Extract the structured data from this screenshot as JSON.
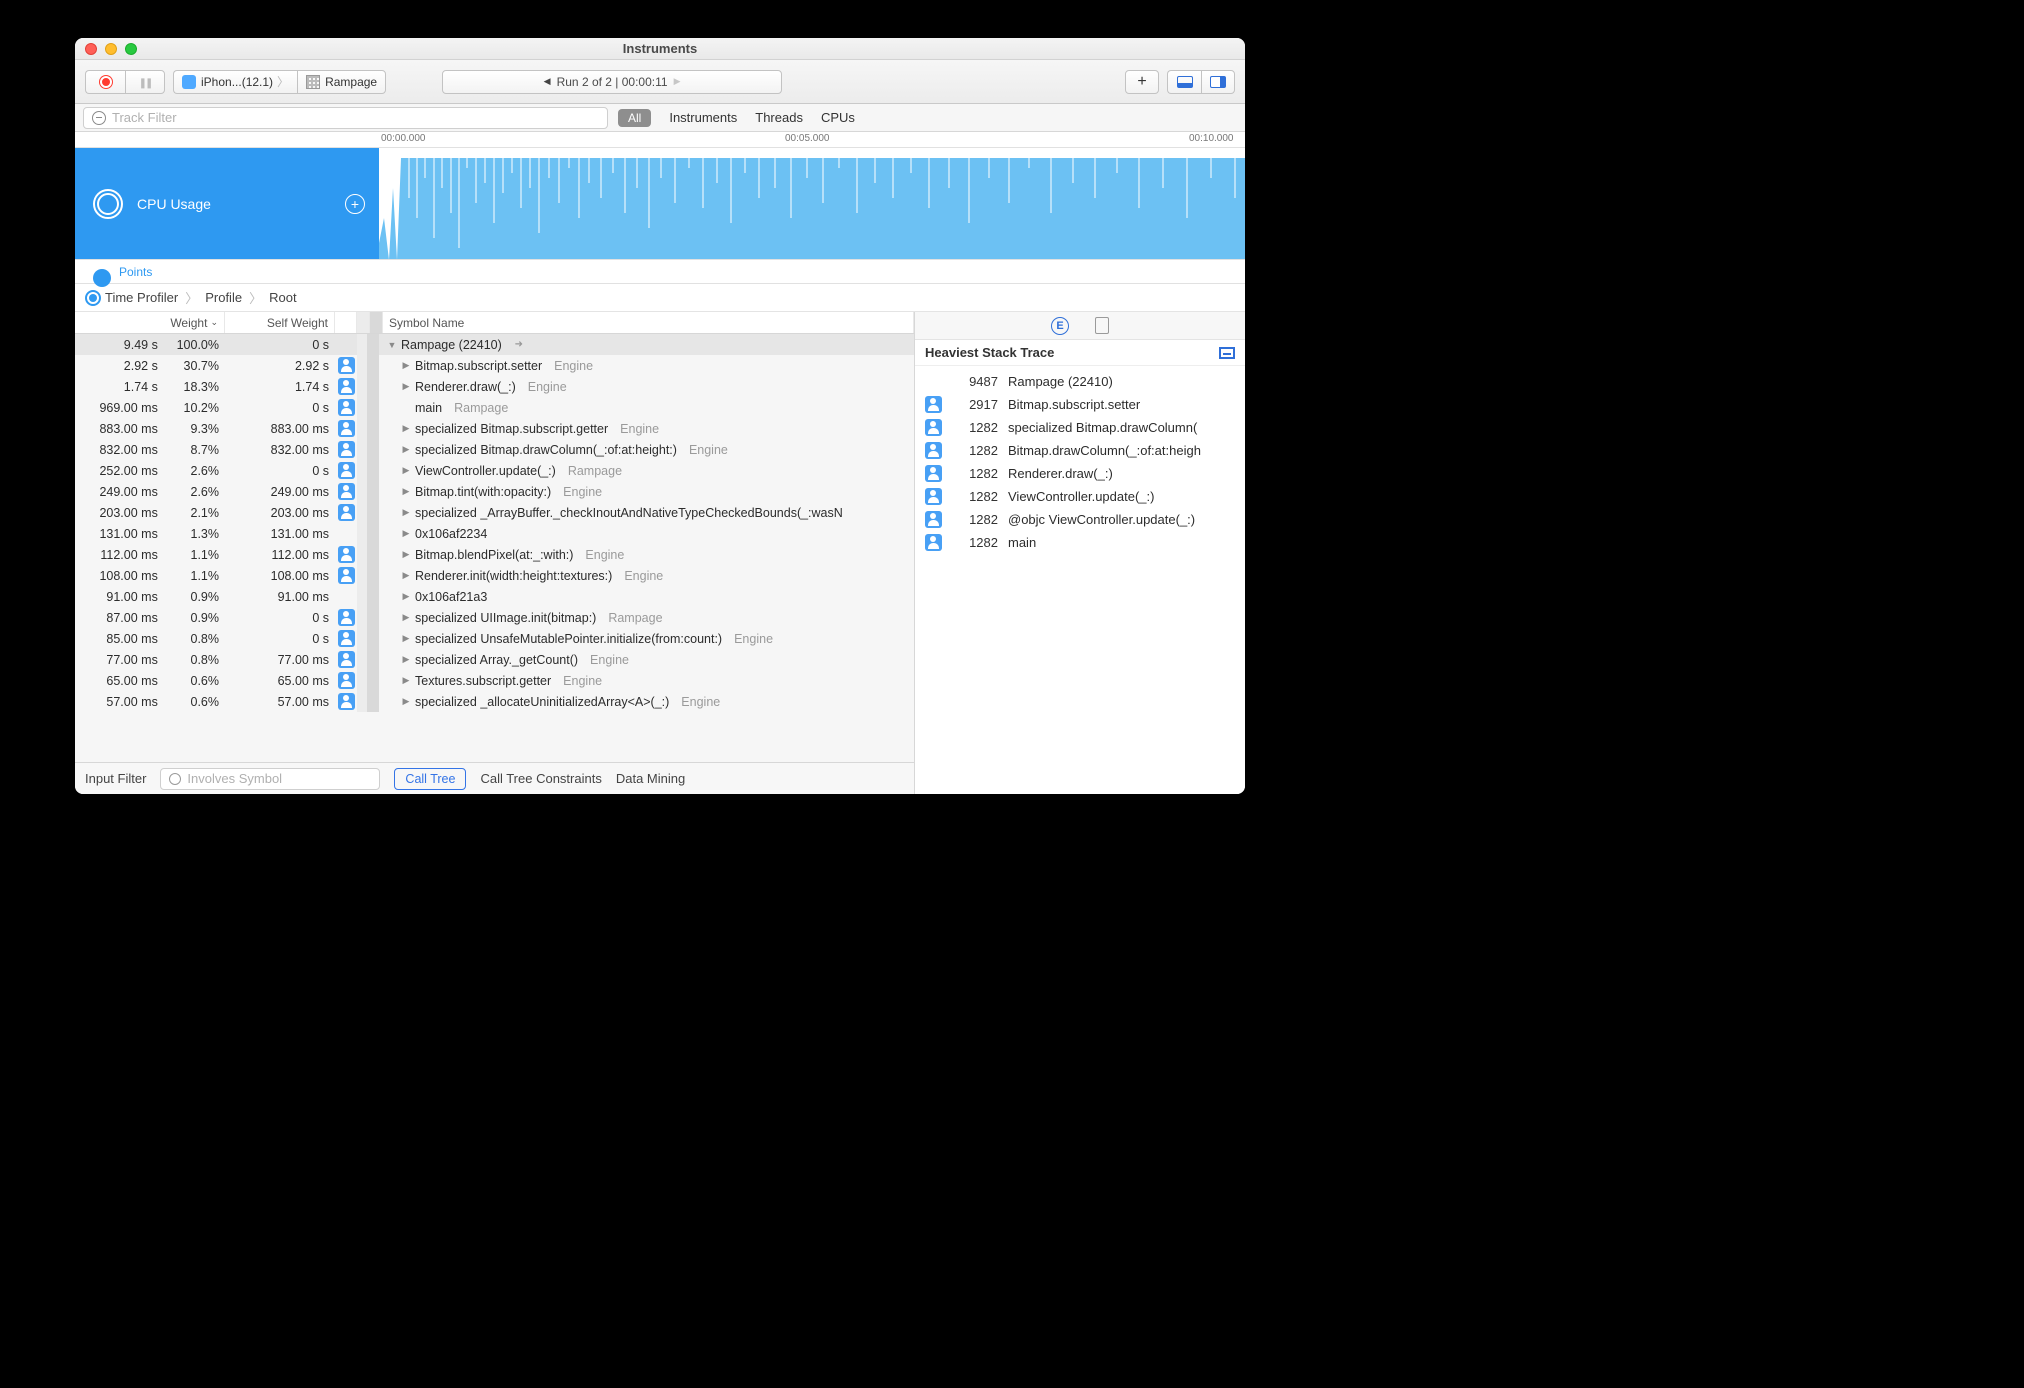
{
  "window": {
    "title": "Instruments"
  },
  "toolbar": {
    "device": "iPhon...(12.1)",
    "target": "Rampage",
    "run_label": "Run 2 of 2  |  00:00:11"
  },
  "filterbar": {
    "placeholder": "Track Filter",
    "all_label": "All",
    "tabs": [
      "Instruments",
      "Threads",
      "CPUs"
    ]
  },
  "ruler": {
    "t0": "00:00.000",
    "t1": "00:05.000",
    "t2": "00:10.000"
  },
  "tracks": {
    "cpu_label": "CPU Usage",
    "points_label": "Points"
  },
  "crumbs": [
    "Time Profiler",
    "Profile",
    "Root"
  ],
  "columns": {
    "weight": "Weight",
    "self_weight": "Self Weight",
    "symbol": "Symbol Name"
  },
  "rows": [
    {
      "weight": "9.49 s",
      "pct": "100.0%",
      "self": "0 s",
      "icon": false,
      "indent": 0,
      "open": true,
      "sym": "Rampage (22410)",
      "lib": "",
      "annot": true,
      "sel": true
    },
    {
      "weight": "2.92 s",
      "pct": "30.7%",
      "self": "2.92 s",
      "icon": true,
      "indent": 1,
      "open": false,
      "sym": "Bitmap.subscript.setter",
      "lib": "Engine"
    },
    {
      "weight": "1.74 s",
      "pct": "18.3%",
      "self": "1.74 s",
      "icon": true,
      "indent": 1,
      "open": false,
      "sym": "Renderer.draw(_:)",
      "lib": "Engine"
    },
    {
      "weight": "969.00 ms",
      "pct": "10.2%",
      "self": "0 s",
      "icon": true,
      "indent": 1,
      "open": null,
      "sym": "main",
      "lib": "Rampage"
    },
    {
      "weight": "883.00 ms",
      "pct": "9.3%",
      "self": "883.00 ms",
      "icon": true,
      "indent": 1,
      "open": false,
      "sym": "specialized Bitmap.subscript.getter",
      "lib": "Engine"
    },
    {
      "weight": "832.00 ms",
      "pct": "8.7%",
      "self": "832.00 ms",
      "icon": true,
      "indent": 1,
      "open": false,
      "sym": "specialized Bitmap.drawColumn(_:of:at:height:)",
      "lib": "Engine"
    },
    {
      "weight": "252.00 ms",
      "pct": "2.6%",
      "self": "0 s",
      "icon": true,
      "indent": 1,
      "open": false,
      "sym": "ViewController.update(_:)",
      "lib": "Rampage"
    },
    {
      "weight": "249.00 ms",
      "pct": "2.6%",
      "self": "249.00 ms",
      "icon": true,
      "indent": 1,
      "open": false,
      "sym": "Bitmap.tint(with:opacity:)",
      "lib": "Engine"
    },
    {
      "weight": "203.00 ms",
      "pct": "2.1%",
      "self": "203.00 ms",
      "icon": true,
      "indent": 1,
      "open": false,
      "sym": "specialized _ArrayBuffer._checkInoutAndNativeTypeCheckedBounds(_:wasN",
      "lib": ""
    },
    {
      "weight": "131.00 ms",
      "pct": "1.3%",
      "self": "131.00 ms",
      "icon": false,
      "indent": 1,
      "open": false,
      "sym": "0x106af2234",
      "lib": ""
    },
    {
      "weight": "112.00 ms",
      "pct": "1.1%",
      "self": "112.00 ms",
      "icon": true,
      "indent": 1,
      "open": false,
      "sym": "Bitmap.blendPixel(at:_:with:)",
      "lib": "Engine"
    },
    {
      "weight": "108.00 ms",
      "pct": "1.1%",
      "self": "108.00 ms",
      "icon": true,
      "indent": 1,
      "open": false,
      "sym": "Renderer.init(width:height:textures:)",
      "lib": "Engine"
    },
    {
      "weight": "91.00 ms",
      "pct": "0.9%",
      "self": "91.00 ms",
      "icon": false,
      "indent": 1,
      "open": false,
      "sym": "0x106af21a3",
      "lib": ""
    },
    {
      "weight": "87.00 ms",
      "pct": "0.9%",
      "self": "0 s",
      "icon": true,
      "indent": 1,
      "open": false,
      "sym": "specialized UIImage.init(bitmap:)",
      "lib": "Rampage"
    },
    {
      "weight": "85.00 ms",
      "pct": "0.8%",
      "self": "0 s",
      "icon": true,
      "indent": 1,
      "open": false,
      "sym": "specialized UnsafeMutablePointer.initialize(from:count:)",
      "lib": "Engine"
    },
    {
      "weight": "77.00 ms",
      "pct": "0.8%",
      "self": "77.00 ms",
      "icon": true,
      "indent": 1,
      "open": false,
      "sym": "specialized Array._getCount()",
      "lib": "Engine"
    },
    {
      "weight": "65.00 ms",
      "pct": "0.6%",
      "self": "65.00 ms",
      "icon": true,
      "indent": 1,
      "open": false,
      "sym": "Textures.subscript.getter",
      "lib": "Engine"
    },
    {
      "weight": "57.00 ms",
      "pct": "0.6%",
      "self": "57.00 ms",
      "icon": true,
      "indent": 1,
      "open": false,
      "sym": "specialized _allocateUninitializedArray<A>(_:)",
      "lib": "Engine"
    }
  ],
  "bottombar": {
    "input_filter": "Input Filter",
    "involves_placeholder": "Involves Symbol",
    "call_tree": "Call Tree",
    "constraints": "Call Tree Constraints",
    "data_mining": "Data Mining"
  },
  "side": {
    "title": "Heaviest Stack Trace",
    "rows": [
      {
        "icon": false,
        "count": "9487",
        "label": "Rampage (22410)"
      },
      {
        "icon": true,
        "count": "2917",
        "label": "Bitmap.subscript.setter"
      },
      {
        "icon": true,
        "count": "1282",
        "label": "specialized Bitmap.drawColumn("
      },
      {
        "icon": true,
        "count": "1282",
        "label": "Bitmap.drawColumn(_:of:at:heigh"
      },
      {
        "icon": true,
        "count": "1282",
        "label": "Renderer.draw(_:)"
      },
      {
        "icon": true,
        "count": "1282",
        "label": "ViewController.update(_:)"
      },
      {
        "icon": true,
        "count": "1282",
        "label": "@objc ViewController.update(_:)"
      },
      {
        "icon": true,
        "count": "1282",
        "label": "main"
      }
    ]
  }
}
